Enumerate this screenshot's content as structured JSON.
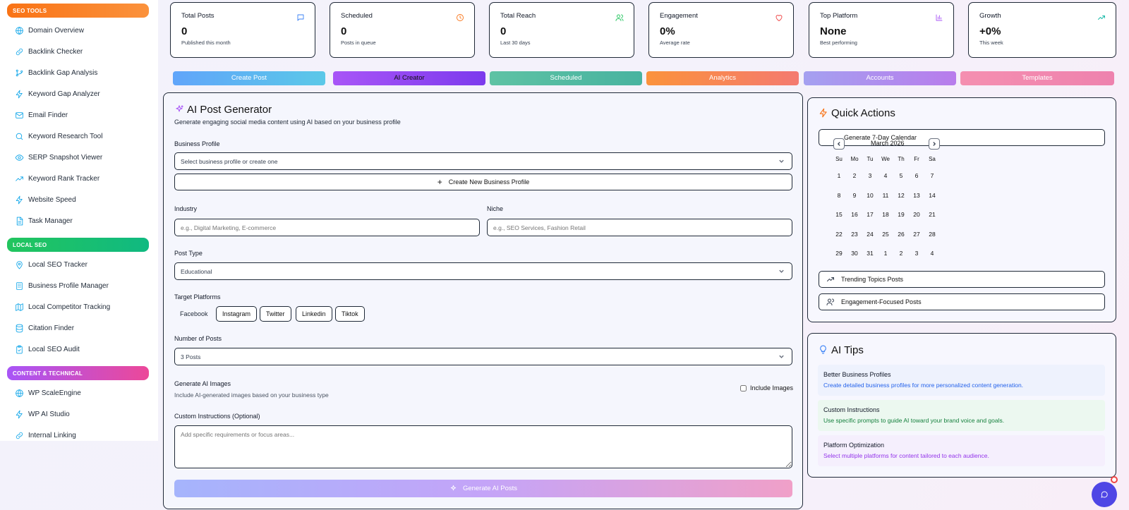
{
  "sidebar": {
    "sections": [
      {
        "title": "SEO TOOLS",
        "items": [
          {
            "label": "Domain Overview",
            "icon": "globe-icon"
          },
          {
            "label": "Backlink Checker",
            "icon": "link-icon"
          },
          {
            "label": "Backlink Gap Analysis",
            "icon": "branch-icon"
          },
          {
            "label": "Keyword Gap Analyzer",
            "icon": "zap-icon"
          },
          {
            "label": "Email Finder",
            "icon": "mail-icon"
          },
          {
            "label": "Keyword Research Tool",
            "icon": "search-icon"
          },
          {
            "label": "SERP Snapshot Viewer",
            "icon": "eye-icon"
          },
          {
            "label": "Keyword Rank Tracker",
            "icon": "trend-icon"
          },
          {
            "label": "Website Speed",
            "icon": "zap-icon"
          },
          {
            "label": "Task Manager",
            "icon": "document-icon"
          }
        ]
      },
      {
        "title": "LOCAL SEO",
        "items": [
          {
            "label": "Local SEO Tracker",
            "icon": "map-pin-icon"
          },
          {
            "label": "Business Profile Manager",
            "icon": "building-icon"
          },
          {
            "label": "Local Competitor Tracking",
            "icon": "map-icon"
          },
          {
            "label": "Citation Finder",
            "icon": "database-icon"
          },
          {
            "label": "Local SEO Audit",
            "icon": "clipboard-icon"
          }
        ]
      },
      {
        "title": "CONTENT & TECHNICAL",
        "items": [
          {
            "label": "WP ScaleEngine",
            "icon": "globe-icon"
          },
          {
            "label": "WP AI Studio",
            "icon": "zap-icon"
          },
          {
            "label": "Internal Linking",
            "icon": "link-icon"
          }
        ]
      }
    ]
  },
  "stats": [
    {
      "title": "Total Posts",
      "value": "0",
      "sub": "Published this month",
      "icon": "message-icon",
      "color": "#3b82f6"
    },
    {
      "title": "Scheduled",
      "value": "0",
      "sub": "Posts in queue",
      "icon": "clock-icon",
      "color": "#f97316"
    },
    {
      "title": "Total Reach",
      "value": "0",
      "sub": "Last 30 days",
      "icon": "users-icon",
      "color": "#22c55e"
    },
    {
      "title": "Engagement",
      "value": "0%",
      "sub": "Average rate",
      "icon": "heart-icon",
      "color": "#ef4444"
    },
    {
      "title": "Top Platform",
      "value": "None",
      "sub": "Best performing",
      "icon": "bar-chart-icon",
      "color": "#a855f7"
    },
    {
      "title": "Growth",
      "value": "+0%",
      "sub": "This week",
      "icon": "trend-up-icon",
      "color": "#14b8a6"
    }
  ],
  "tabs": [
    {
      "label": "Create Post",
      "gradient": [
        "#60a5fa",
        "#5bc8e8"
      ]
    },
    {
      "label": "AI Creator",
      "gradient": [
        "#a855f7",
        "#7c3aed"
      ]
    },
    {
      "label": "Scheduled",
      "gradient": [
        "#5ec2a4",
        "#48b3a0"
      ]
    },
    {
      "label": "Analytics",
      "gradient": [
        "#fb923c",
        "#f47a70"
      ]
    },
    {
      "label": "Accounts",
      "gradient": [
        "#a5a0f0",
        "#b87cec"
      ]
    },
    {
      "label": "Templates",
      "gradient": [
        "#f58fb0",
        "#ee82ae"
      ]
    }
  ],
  "generator": {
    "title": "AI Post Generator",
    "subtitle": "Generate engaging social media content using AI based on your business profile",
    "business_profile_label": "Business Profile",
    "business_profile_value": "Select business profile or create one",
    "create_profile_label": "Create New Business Profile",
    "industry_label": "Industry",
    "industry_placeholder": "e.g., Digital Marketing, E-commerce",
    "niche_label": "Niche",
    "niche_placeholder": "e.g., SEO Services, Fashion Retail",
    "post_type_label": "Post Type",
    "post_type_value": "Educational",
    "platforms_label": "Target Platforms",
    "platforms": [
      "Facebook",
      "Instagram",
      "Twitter",
      "Linkedin",
      "Tiktok"
    ],
    "num_posts_label": "Number of Posts",
    "num_posts_value": "3 Posts",
    "images_label": "Generate AI Images",
    "images_desc": "Include AI-generated images based on your business type",
    "include_images_label": "Include Images",
    "custom_label": "Custom Instructions (Optional)",
    "custom_placeholder": "Add specific requirements or focus areas...",
    "generate_label": "Generate AI Posts"
  },
  "quick_actions": {
    "title": "Quick Actions",
    "calendar_button": "Generate 7-Day Calendar",
    "month": "March 2026",
    "weekdays": [
      "Su",
      "Mo",
      "Tu",
      "We",
      "Th",
      "Fr",
      "Sa"
    ],
    "weeks": [
      [
        "1",
        "2",
        "3",
        "4",
        "5",
        "6",
        "7"
      ],
      [
        "8",
        "9",
        "10",
        "11",
        "12",
        "13",
        "14"
      ],
      [
        "15",
        "16",
        "17",
        "18",
        "19",
        "20",
        "21"
      ],
      [
        "22",
        "23",
        "24",
        "25",
        "26",
        "27",
        "28"
      ],
      [
        "29",
        "30",
        "31",
        "1",
        "2",
        "3",
        "4"
      ]
    ],
    "trending_label": "Trending Topics Posts",
    "engagement_label": "Engagement-Focused Posts"
  },
  "tips": {
    "title": "AI Tips",
    "items": [
      {
        "title": "Better Business Profiles",
        "desc": "Create detailed business profiles for more personalized content generation.",
        "bg": "#eef2fd",
        "color": "#2563eb"
      },
      {
        "title": "Custom Instructions",
        "desc": "Use specific prompts to guide AI toward your brand voice and goals.",
        "bg": "#ecf8f0",
        "color": "#15803d"
      },
      {
        "title": "Platform Optimization",
        "desc": "Select multiple platforms for content tailored to each audience.",
        "bg": "#f5effd",
        "color": "#9333ea"
      }
    ]
  }
}
